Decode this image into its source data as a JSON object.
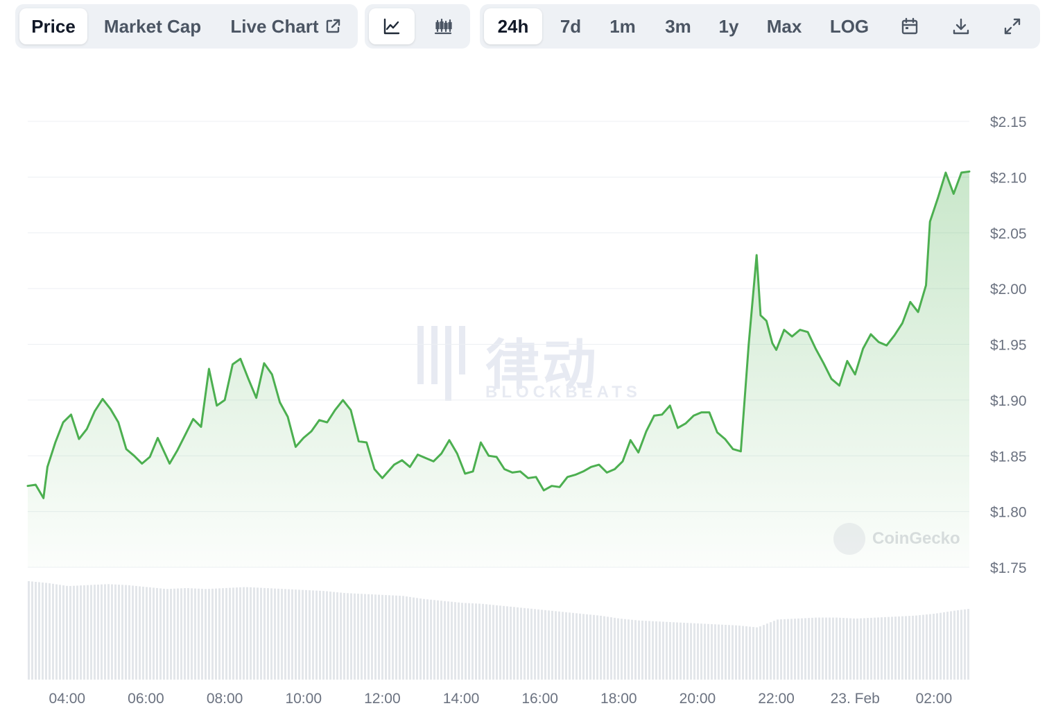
{
  "toolbar": {
    "tabs": [
      {
        "label": "Price",
        "active": true
      },
      {
        "label": "Market Cap",
        "active": false
      },
      {
        "label": "Live Chart",
        "active": false
      }
    ],
    "chart_types": [
      {
        "icon": "line-chart-icon",
        "active": true
      },
      {
        "icon": "candlestick-chart-icon",
        "active": false
      }
    ],
    "ranges": [
      {
        "label": "24h",
        "active": true
      },
      {
        "label": "7d",
        "active": false
      },
      {
        "label": "1m",
        "active": false
      },
      {
        "label": "3m",
        "active": false
      },
      {
        "label": "1y",
        "active": false
      },
      {
        "label": "Max",
        "active": false
      },
      {
        "label": "LOG",
        "active": false
      }
    ],
    "tools": [
      {
        "icon": "calendar-icon"
      },
      {
        "icon": "download-icon"
      },
      {
        "icon": "expand-icon"
      }
    ]
  },
  "watermarks": {
    "coingecko": "CoinGecko",
    "blockbeats": "律动",
    "blockbeats_sub": "BLOCKBEATS"
  },
  "colors": {
    "line": "#4caf50",
    "fill": "#4caf50",
    "grid": "#eceff3",
    "volume": "#e3e6ea",
    "axis_text": "#6b7280"
  },
  "chart_data": {
    "type": "area",
    "title": "",
    "xlabel": "",
    "ylabel": "",
    "ylim": [
      1.75,
      2.15
    ],
    "y_ticks": [
      2.15,
      2.1,
      2.05,
      2.0,
      1.95,
      1.9,
      1.85,
      1.8,
      1.75
    ],
    "y_tick_labels": [
      "$2.15",
      "$2.10",
      "$2.05",
      "$2.00",
      "$1.95",
      "$1.90",
      "$1.85",
      "$1.80",
      "$1.75"
    ],
    "x_range_hours": [
      3.0,
      26.9
    ],
    "x_ticks": [
      4,
      6,
      8,
      10,
      12,
      14,
      16,
      18,
      20,
      22,
      24,
      26
    ],
    "x_tick_labels": [
      "04:00",
      "06:00",
      "08:00",
      "10:00",
      "12:00",
      "14:00",
      "16:00",
      "18:00",
      "20:00",
      "22:00",
      "23. Feb",
      "02:00"
    ],
    "grid": true,
    "legend": "none",
    "series": [
      {
        "x": [
          3.0,
          3.2,
          3.4,
          3.5,
          3.7,
          3.9,
          4.1,
          4.3,
          4.5,
          4.7,
          4.9,
          5.1,
          5.3,
          5.5,
          5.7,
          5.9,
          6.1,
          6.3,
          6.6,
          6.8,
          7.0,
          7.2,
          7.4,
          7.6,
          7.8,
          8.0,
          8.2,
          8.4,
          8.6,
          8.8,
          9.0,
          9.2,
          9.4,
          9.6,
          9.8,
          10.0,
          10.2,
          10.4,
          10.6,
          10.8,
          11.0,
          11.2,
          11.4,
          11.6,
          11.8,
          12.0,
          12.3,
          12.5,
          12.7,
          12.9,
          13.1,
          13.3,
          13.5,
          13.7,
          13.9,
          14.1,
          14.3,
          14.5,
          14.7,
          14.9,
          15.1,
          15.3,
          15.5,
          15.7,
          15.9,
          16.1,
          16.3,
          16.5,
          16.7,
          16.9,
          17.1,
          17.3,
          17.5,
          17.7,
          17.9,
          18.1,
          18.3,
          18.5,
          18.7,
          18.9,
          19.1,
          19.3,
          19.5,
          19.7,
          19.9,
          20.1,
          20.3,
          20.5,
          20.7,
          20.9,
          21.1,
          21.3,
          21.5,
          21.6,
          21.75,
          21.9,
          22.0,
          22.2,
          22.4,
          22.6,
          22.8,
          23.0,
          23.2,
          23.4,
          23.6,
          23.8,
          24.0,
          24.2,
          24.4,
          24.6,
          24.8,
          25.0,
          25.2,
          25.4,
          25.6,
          25.8,
          25.9,
          26.1,
          26.3,
          26.5,
          26.7,
          26.9
        ],
        "y": [
          1.823,
          1.824,
          1.812,
          1.84,
          1.862,
          1.88,
          1.887,
          1.865,
          1.874,
          1.89,
          1.901,
          1.892,
          1.88,
          1.856,
          1.85,
          1.843,
          1.849,
          1.866,
          1.843,
          1.855,
          1.869,
          1.883,
          1.876,
          1.928,
          1.895,
          1.9,
          1.932,
          1.937,
          1.919,
          1.902,
          1.933,
          1.923,
          1.898,
          1.885,
          1.858,
          1.866,
          1.872,
          1.882,
          1.88,
          1.891,
          1.9,
          1.891,
          1.863,
          1.862,
          1.838,
          1.83,
          1.842,
          1.846,
          1.84,
          1.851,
          1.848,
          1.845,
          1.852,
          1.864,
          1.852,
          1.834,
          1.836,
          1.862,
          1.85,
          1.849,
          1.838,
          1.835,
          1.836,
          1.83,
          1.831,
          1.819,
          1.823,
          1.822,
          1.831,
          1.833,
          1.836,
          1.84,
          1.842,
          1.835,
          1.838,
          1.845,
          1.864,
          1.853,
          1.872,
          1.886,
          1.887,
          1.895,
          1.875,
          1.879,
          1.886,
          1.889,
          1.889,
          1.871,
          1.865,
          1.856,
          1.854,
          1.95,
          2.03,
          1.976,
          1.971,
          1.951,
          1.945,
          1.963,
          1.957,
          1.963,
          1.961,
          1.946,
          1.933,
          1.919,
          1.913,
          1.935,
          1.923,
          1.946,
          1.959,
          1.952,
          1.949,
          1.958,
          1.969,
          1.988,
          1.979,
          2.003,
          2.06,
          2.081,
          2.104,
          2.085,
          2.104,
          2.105
        ]
      }
    ],
    "volume": {
      "x": [
        3.0,
        3.5,
        4.0,
        4.5,
        5.0,
        5.5,
        6.0,
        6.5,
        7.0,
        7.5,
        8.0,
        8.5,
        9.0,
        9.5,
        10.0,
        10.5,
        11.0,
        11.5,
        12.0,
        12.5,
        13.0,
        13.5,
        14.0,
        14.5,
        15.0,
        15.5,
        16.0,
        16.5,
        17.0,
        17.5,
        18.0,
        18.5,
        19.0,
        19.5,
        20.0,
        20.5,
        21.0,
        21.5,
        22.0,
        22.5,
        23.0,
        23.5,
        24.0,
        24.5,
        25.0,
        25.5,
        26.0,
        26.5,
        26.9
      ],
      "values": [
        100,
        98,
        95,
        96,
        97,
        96,
        94,
        92,
        93,
        92,
        93,
        94,
        93,
        92,
        91,
        90,
        88,
        87,
        86,
        85,
        82,
        80,
        78,
        77,
        75,
        73,
        71,
        69,
        67,
        65,
        62,
        60,
        59,
        58,
        57,
        56,
        55,
        53,
        61,
        62,
        63,
        63,
        62,
        63,
        64,
        65,
        67,
        70,
        72
      ]
    }
  }
}
